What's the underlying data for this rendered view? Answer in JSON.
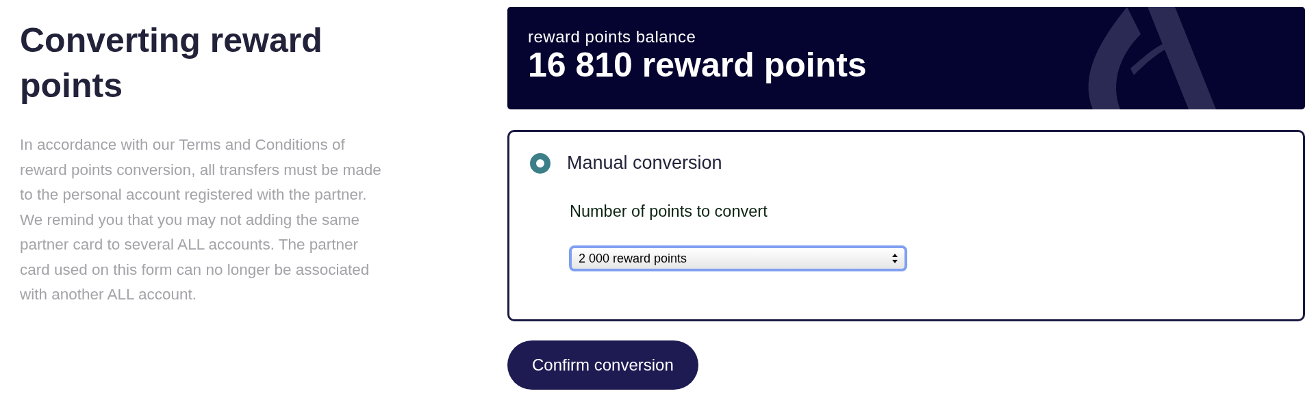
{
  "intro": {
    "title": "Converting reward points",
    "text": "In accordance with our Terms and Conditions of reward points conversion, all transfers must be made to the personal account registered with the partner. We remind you that you may not adding the same partner card to several ALL accounts. The partner card used on this form can no longer be associated with another ALL account."
  },
  "balance": {
    "label": "reward points balance",
    "value": "16 810 reward points"
  },
  "options": [
    {
      "label": "Manual conversion",
      "selected": true,
      "field_label": "Number of points to convert",
      "value": "2 000 reward points"
    }
  ],
  "buttons": [
    "Confirm conversion"
  ]
}
